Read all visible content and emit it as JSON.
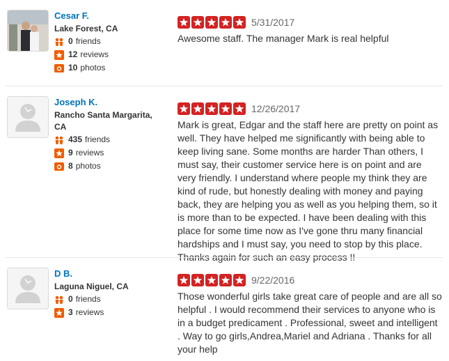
{
  "colors": {
    "star": "#d32323",
    "link": "#0073bb",
    "friends_icon": "#f15c00",
    "reviews_icon": "#f15c00",
    "photos_icon": "#f15c00"
  },
  "reviews": [
    {
      "user": {
        "name": "Cesar F.",
        "location": "Lake Forest, CA",
        "friends": "0",
        "friends_label": "friends",
        "reviews": "12",
        "reviews_label": "reviews",
        "photos": "10",
        "photos_label": "photos",
        "avatar": "photo"
      },
      "rating": 5,
      "date": "5/31/2017",
      "text": "Awesome staff. The manager Mark is real helpful"
    },
    {
      "user": {
        "name": "Joseph K.",
        "location": "Rancho Santa Margarita, CA",
        "friends": "435",
        "friends_label": "friends",
        "reviews": "9",
        "reviews_label": "reviews",
        "photos": "8",
        "photos_label": "photos",
        "avatar": "default"
      },
      "rating": 5,
      "date": "12/26/2017",
      "text": "Mark is great, Edgar and the staff here are pretty on point as well. They have helped me significantly with being able to keep living sane. Some months are harder Than others, I must say, their customer service here is on point and are very friendly. I understand where people my think they are kind of rude, but honestly dealing with money and paying back, they are helping you as well as you helping them, so it is more than to be expected. I have been dealing with this place for some time now as I've gone thru many financial hardships and I must say, you need to stop by this place. Thanks again for such an easy process !!"
    },
    {
      "user": {
        "name": "D B.",
        "location": "Laguna Niguel, CA",
        "friends": "0",
        "friends_label": "friends",
        "reviews": "3",
        "reviews_label": "reviews",
        "avatar": "default"
      },
      "rating": 5,
      "date": "9/22/2016",
      "text": "Those wonderful girls take great care of people and are all so helpful . I would recommend their services to anyone who is in a budget predicament . Professional, sweet and intelligent . Way to go girls,Andrea,Mariel and Adriana . Thanks for all your help"
    }
  ]
}
